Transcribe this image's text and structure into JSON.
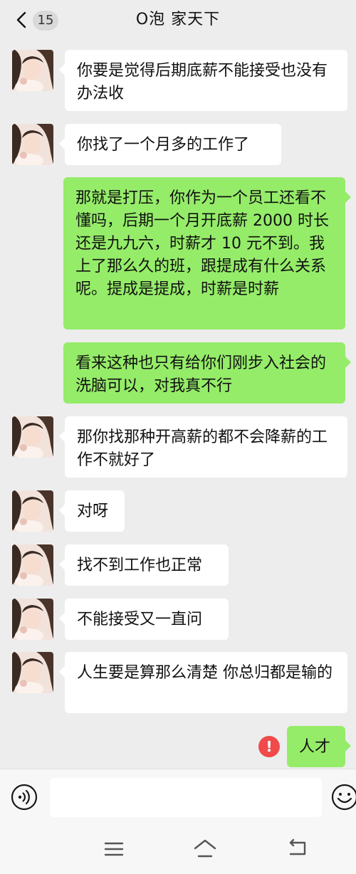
{
  "header": {
    "unread_count": "15",
    "title": "O泡  家天下"
  },
  "messages": [
    {
      "side": "left",
      "text": "你要是觉得后期底薪不能接受也没有办法收"
    },
    {
      "side": "left",
      "text": "你找了一个月多的工作了"
    },
    {
      "side": "right",
      "text": "那就是打压，你作为一个员工还看不懂吗，后期一个月开底薪 2000 时长还是九九六，时薪才 10 元不到。我上了那么久的班，跟提成有什么关系呢。提成是提成，时薪是时薪"
    },
    {
      "side": "right",
      "text": "看来这种也只有给你们刚步入社会的洗脑可以，对我真不行"
    },
    {
      "side": "left",
      "text": "那你找那种开高薪的都不会降薪的工作不就好了"
    },
    {
      "side": "left",
      "text": "对呀"
    },
    {
      "side": "left",
      "text": "找不到工作也正常"
    },
    {
      "side": "left",
      "text": "不能接受又一直问"
    },
    {
      "side": "left",
      "text": "人生要是算那么清楚  你总归都是输的"
    },
    {
      "side": "right",
      "text": "人才",
      "failed": true,
      "error_mark": "!"
    }
  ],
  "input": {
    "value": "",
    "placeholder": ""
  },
  "colors": {
    "background": "#ededed",
    "incoming_bubble": "#ffffff",
    "outgoing_bubble": "#95ec69",
    "error": "#f04a4a"
  },
  "icons": [
    "back-chevron-icon",
    "voice-icon",
    "emoji-icon",
    "menu-icon",
    "home-icon",
    "back-icon"
  ]
}
